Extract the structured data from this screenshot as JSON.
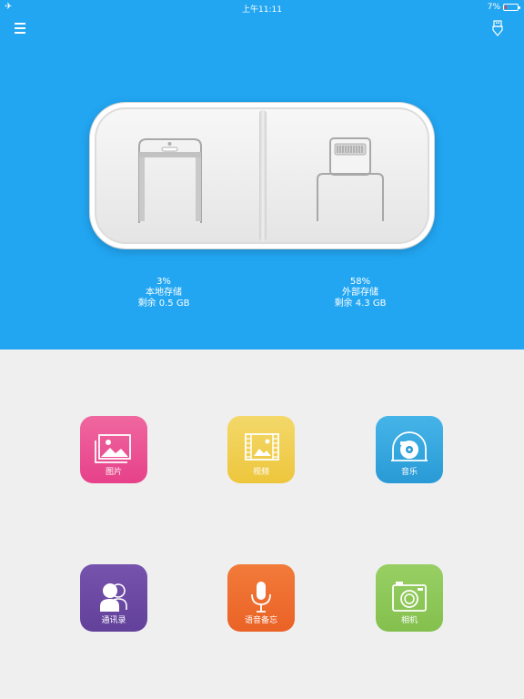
{
  "status_bar": {
    "time": "上午11:11",
    "battery": "7%",
    "battery_level": 0.07
  },
  "storage": {
    "local": {
      "percent": "3%",
      "label": "本地存储",
      "free": "剩余 0.5 GB"
    },
    "external": {
      "percent": "58%",
      "label": "外部存储",
      "free": "剩余 4.3 GB"
    }
  },
  "apps": [
    {
      "label": "图片",
      "icon": "photo-icon",
      "color": "#e94b8c"
    },
    {
      "label": "视频",
      "icon": "film-icon",
      "color": "#efcc4b"
    },
    {
      "label": "音乐",
      "icon": "music-disc-icon",
      "color": "#2ea2dc"
    },
    {
      "label": "通讯录",
      "icon": "contacts-icon",
      "color": "#6a4aa2"
    },
    {
      "label": "语音备忘",
      "icon": "microphone-icon",
      "color": "#ef6a2c"
    },
    {
      "label": "相机",
      "icon": "camera-icon",
      "color": "#8ec85a"
    }
  ],
  "colors": {
    "header_bg": "#22a6f2",
    "body_bg": "#efefef"
  }
}
